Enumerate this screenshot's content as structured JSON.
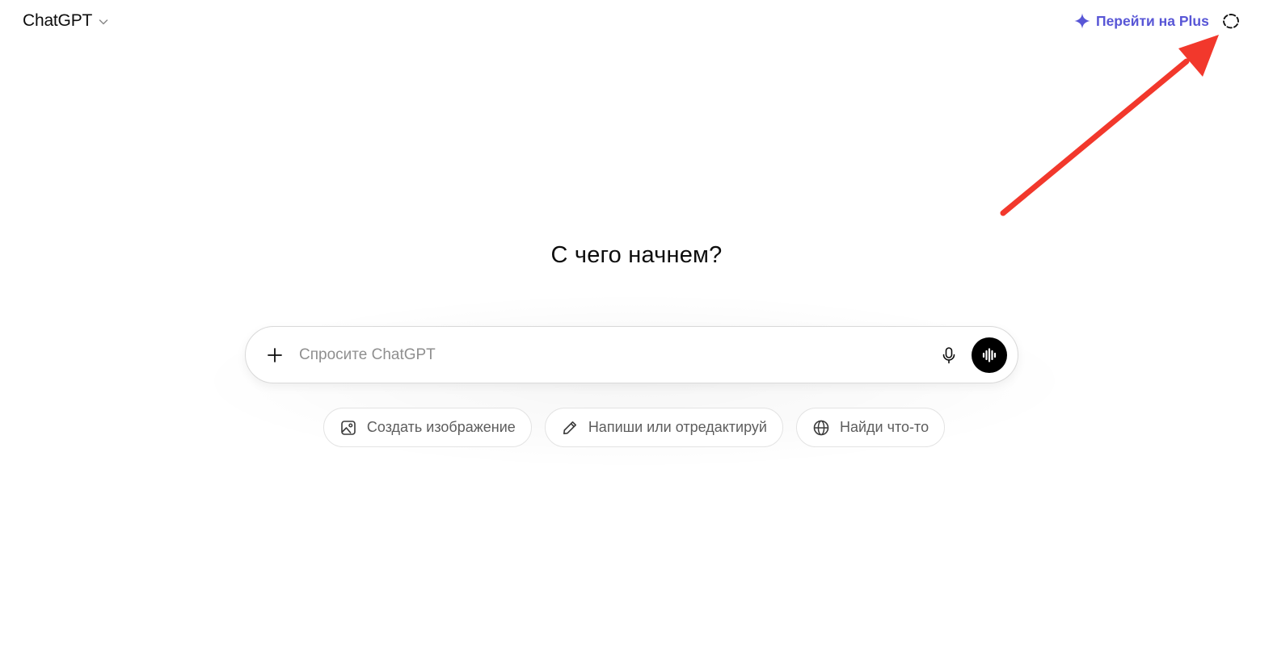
{
  "header": {
    "model_name": "ChatGPT",
    "upgrade_label": "Перейти на Plus",
    "accent_color": "#5856d6"
  },
  "main": {
    "heading": "С чего начнем?",
    "composer": {
      "placeholder": "Спросите ChatGPT"
    },
    "suggestions": [
      {
        "label": "Создать изображение",
        "icon": "image-icon"
      },
      {
        "label": "Напиши или отредактируй",
        "icon": "pencil-icon"
      },
      {
        "label": "Найди что-то",
        "icon": "globe-icon"
      }
    ]
  },
  "annotation": {
    "arrow_color": "#f2382c",
    "points_to": "temporary-chat-button"
  }
}
